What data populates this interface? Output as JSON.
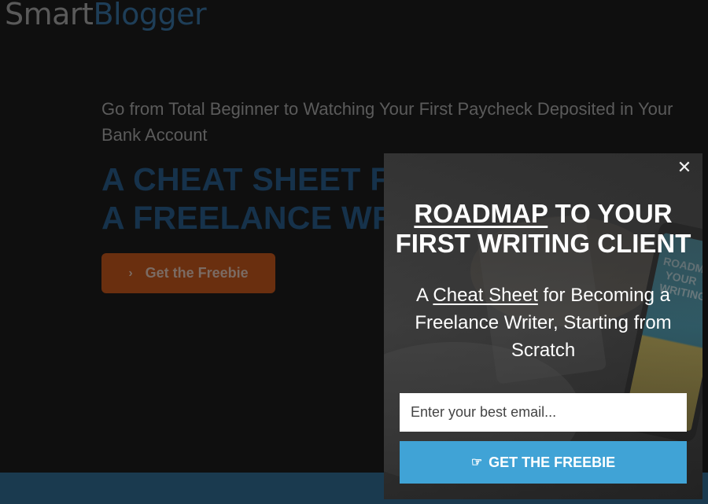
{
  "brand": {
    "part1": "Smart",
    "part2": "Blogger"
  },
  "hero": {
    "subtitle": "Go from Total Beginner to Watching Your First Paycheck Deposited in Your Bank Account",
    "title_line1": "A CHEAT SHEET F",
    "title_line2": "A FREELANCE WR",
    "cta_label": "Get the Freebie",
    "cta_icon": "chevron-right-icon"
  },
  "popup": {
    "close_glyph": "✕",
    "title_underlined": "ROADMAP",
    "title_rest_line1": " TO YOUR",
    "title_line2": "FIRST WRITING CLIENT",
    "sub_prefix": "A ",
    "sub_underlined": "Cheat Sheet",
    "sub_rest": " for Becoming a Freelance Writer, Starting from Scratch",
    "email_placeholder": "Enter your best email...",
    "submit_label": "GET THE FREEBIE",
    "submit_icon": "pointing-hand-icon",
    "bg_book_text": "ROADMAP TO YOUR WRITING"
  },
  "colors": {
    "brand_dark": "#1e3e58",
    "hero_cta": "#6a2f0f",
    "popup_button": "#40a3d6",
    "bottom_band": "#1a3a4f"
  }
}
